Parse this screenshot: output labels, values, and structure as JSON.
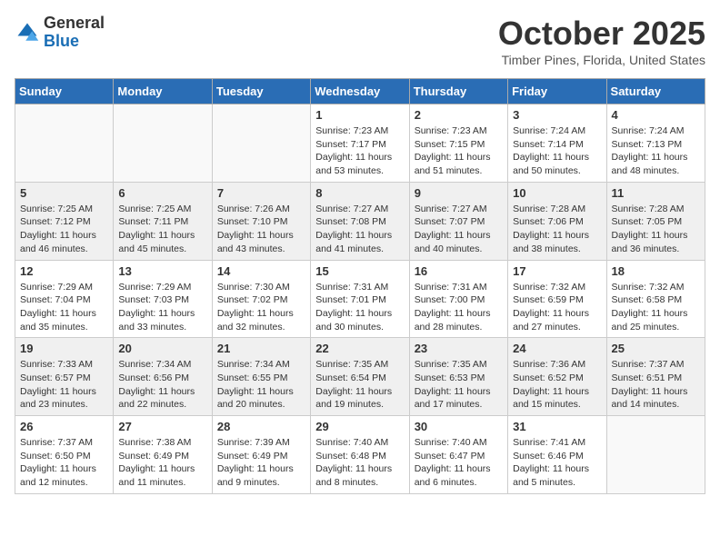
{
  "logo": {
    "general": "General",
    "blue": "Blue"
  },
  "title": "October 2025",
  "location": "Timber Pines, Florida, United States",
  "days_of_week": [
    "Sunday",
    "Monday",
    "Tuesday",
    "Wednesday",
    "Thursday",
    "Friday",
    "Saturday"
  ],
  "weeks": [
    [
      {
        "day": "",
        "info": ""
      },
      {
        "day": "",
        "info": ""
      },
      {
        "day": "",
        "info": ""
      },
      {
        "day": "1",
        "info": "Sunrise: 7:23 AM\nSunset: 7:17 PM\nDaylight: 11 hours\nand 53 minutes."
      },
      {
        "day": "2",
        "info": "Sunrise: 7:23 AM\nSunset: 7:15 PM\nDaylight: 11 hours\nand 51 minutes."
      },
      {
        "day": "3",
        "info": "Sunrise: 7:24 AM\nSunset: 7:14 PM\nDaylight: 11 hours\nand 50 minutes."
      },
      {
        "day": "4",
        "info": "Sunrise: 7:24 AM\nSunset: 7:13 PM\nDaylight: 11 hours\nand 48 minutes."
      }
    ],
    [
      {
        "day": "5",
        "info": "Sunrise: 7:25 AM\nSunset: 7:12 PM\nDaylight: 11 hours\nand 46 minutes."
      },
      {
        "day": "6",
        "info": "Sunrise: 7:25 AM\nSunset: 7:11 PM\nDaylight: 11 hours\nand 45 minutes."
      },
      {
        "day": "7",
        "info": "Sunrise: 7:26 AM\nSunset: 7:10 PM\nDaylight: 11 hours\nand 43 minutes."
      },
      {
        "day": "8",
        "info": "Sunrise: 7:27 AM\nSunset: 7:08 PM\nDaylight: 11 hours\nand 41 minutes."
      },
      {
        "day": "9",
        "info": "Sunrise: 7:27 AM\nSunset: 7:07 PM\nDaylight: 11 hours\nand 40 minutes."
      },
      {
        "day": "10",
        "info": "Sunrise: 7:28 AM\nSunset: 7:06 PM\nDaylight: 11 hours\nand 38 minutes."
      },
      {
        "day": "11",
        "info": "Sunrise: 7:28 AM\nSunset: 7:05 PM\nDaylight: 11 hours\nand 36 minutes."
      }
    ],
    [
      {
        "day": "12",
        "info": "Sunrise: 7:29 AM\nSunset: 7:04 PM\nDaylight: 11 hours\nand 35 minutes."
      },
      {
        "day": "13",
        "info": "Sunrise: 7:29 AM\nSunset: 7:03 PM\nDaylight: 11 hours\nand 33 minutes."
      },
      {
        "day": "14",
        "info": "Sunrise: 7:30 AM\nSunset: 7:02 PM\nDaylight: 11 hours\nand 32 minutes."
      },
      {
        "day": "15",
        "info": "Sunrise: 7:31 AM\nSunset: 7:01 PM\nDaylight: 11 hours\nand 30 minutes."
      },
      {
        "day": "16",
        "info": "Sunrise: 7:31 AM\nSunset: 7:00 PM\nDaylight: 11 hours\nand 28 minutes."
      },
      {
        "day": "17",
        "info": "Sunrise: 7:32 AM\nSunset: 6:59 PM\nDaylight: 11 hours\nand 27 minutes."
      },
      {
        "day": "18",
        "info": "Sunrise: 7:32 AM\nSunset: 6:58 PM\nDaylight: 11 hours\nand 25 minutes."
      }
    ],
    [
      {
        "day": "19",
        "info": "Sunrise: 7:33 AM\nSunset: 6:57 PM\nDaylight: 11 hours\nand 23 minutes."
      },
      {
        "day": "20",
        "info": "Sunrise: 7:34 AM\nSunset: 6:56 PM\nDaylight: 11 hours\nand 22 minutes."
      },
      {
        "day": "21",
        "info": "Sunrise: 7:34 AM\nSunset: 6:55 PM\nDaylight: 11 hours\nand 20 minutes."
      },
      {
        "day": "22",
        "info": "Sunrise: 7:35 AM\nSunset: 6:54 PM\nDaylight: 11 hours\nand 19 minutes."
      },
      {
        "day": "23",
        "info": "Sunrise: 7:35 AM\nSunset: 6:53 PM\nDaylight: 11 hours\nand 17 minutes."
      },
      {
        "day": "24",
        "info": "Sunrise: 7:36 AM\nSunset: 6:52 PM\nDaylight: 11 hours\nand 15 minutes."
      },
      {
        "day": "25",
        "info": "Sunrise: 7:37 AM\nSunset: 6:51 PM\nDaylight: 11 hours\nand 14 minutes."
      }
    ],
    [
      {
        "day": "26",
        "info": "Sunrise: 7:37 AM\nSunset: 6:50 PM\nDaylight: 11 hours\nand 12 minutes."
      },
      {
        "day": "27",
        "info": "Sunrise: 7:38 AM\nSunset: 6:49 PM\nDaylight: 11 hours\nand 11 minutes."
      },
      {
        "day": "28",
        "info": "Sunrise: 7:39 AM\nSunset: 6:49 PM\nDaylight: 11 hours\nand 9 minutes."
      },
      {
        "day": "29",
        "info": "Sunrise: 7:40 AM\nSunset: 6:48 PM\nDaylight: 11 hours\nand 8 minutes."
      },
      {
        "day": "30",
        "info": "Sunrise: 7:40 AM\nSunset: 6:47 PM\nDaylight: 11 hours\nand 6 minutes."
      },
      {
        "day": "31",
        "info": "Sunrise: 7:41 AM\nSunset: 6:46 PM\nDaylight: 11 hours\nand 5 minutes."
      },
      {
        "day": "",
        "info": ""
      }
    ]
  ]
}
